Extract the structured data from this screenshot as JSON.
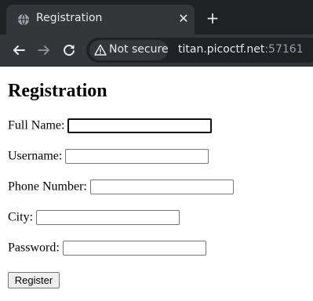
{
  "browser": {
    "tab": {
      "title": "Registration",
      "favicon": "globe-icon",
      "close_icon": "close-icon"
    },
    "new_tab_icon": "plus-icon",
    "nav": {
      "back_icon": "arrow-left-icon",
      "forward_icon": "arrow-right-icon",
      "reload_icon": "reload-icon"
    },
    "address_bar": {
      "security_icon": "warning-triangle-icon",
      "security_label": "Not secure",
      "host": "titan.picoctf.net",
      "port": ":57161"
    },
    "colors": {
      "chrome_bg": "#202124",
      "toolbar_bg": "#35363a",
      "text": "#e8eaed",
      "muted_text": "#9aa0a6"
    }
  },
  "form": {
    "heading": "Registration",
    "fields": [
      {
        "label": "Full Name:",
        "value": "",
        "focused": true
      },
      {
        "label": "Username:",
        "value": ""
      },
      {
        "label": "Phone Number:",
        "value": ""
      },
      {
        "label": "City:",
        "value": ""
      },
      {
        "label": "Password:",
        "value": ""
      }
    ],
    "submit_label": "Register"
  }
}
